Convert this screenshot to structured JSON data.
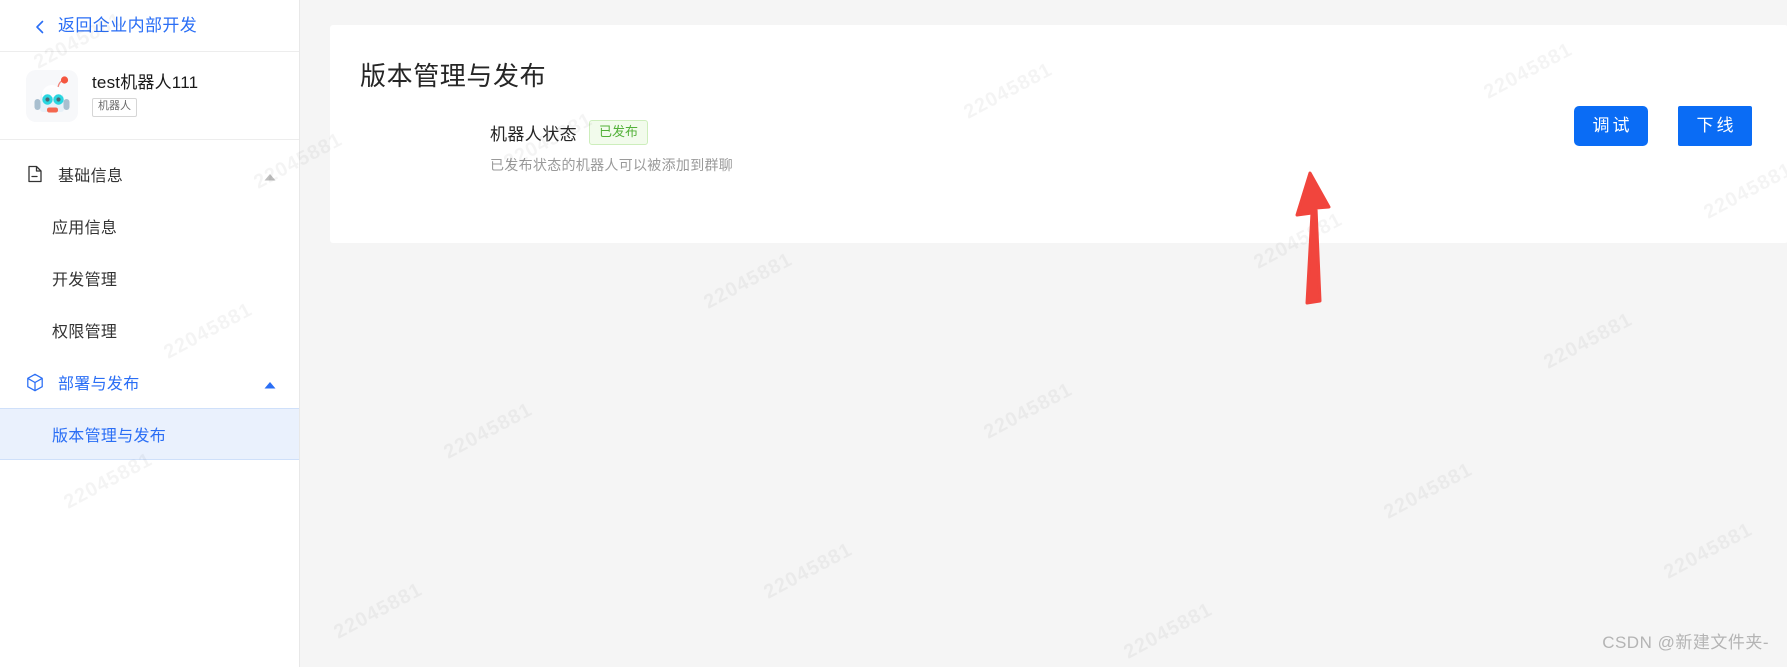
{
  "sidebar": {
    "back_link": {
      "label": "返回企业内部开发",
      "icon": "chevron-left-icon"
    },
    "app": {
      "name": "test机器人111",
      "tag": "机器人",
      "avatar_icon": "robot-avatar-icon"
    },
    "groups": [
      {
        "label": "基础信息",
        "icon": "document-icon",
        "expanded": true,
        "active": false,
        "caret": "caret-up-icon",
        "items": [
          {
            "label": "应用信息",
            "selected": false
          },
          {
            "label": "开发管理",
            "selected": false
          },
          {
            "label": "权限管理",
            "selected": false
          }
        ]
      },
      {
        "label": "部署与发布",
        "icon": "cube-icon",
        "expanded": true,
        "active": true,
        "caret": "caret-up-icon",
        "items": [
          {
            "label": "版本管理与发布",
            "selected": true
          }
        ]
      }
    ]
  },
  "main": {
    "page_title": "版本管理与发布",
    "status": {
      "label": "机器人状态",
      "badge": "已发布",
      "description": "已发布状态的机器人可以被添加到群聊"
    },
    "actions": [
      {
        "label": "调试",
        "name": "debug-button",
        "style": "rounded"
      },
      {
        "label": "下线",
        "name": "offline-button",
        "style": "square"
      }
    ]
  },
  "annotation": {
    "arrow": "red-arrow-up-icon",
    "color": "#f1453d"
  },
  "watermark": {
    "text": "22045881",
    "credit": "CSDN @新建文件夹-"
  },
  "colors": {
    "primary": "#0a6cf5",
    "link": "#2a6ef5",
    "selected_bg": "#eaf1fd",
    "badge_text": "#52b038",
    "badge_bg": "#f2fbec",
    "badge_border": "#cdeebc",
    "page_bg": "#f5f5f5",
    "card_bg": "#ffffff",
    "annotation": "#f1453d"
  }
}
